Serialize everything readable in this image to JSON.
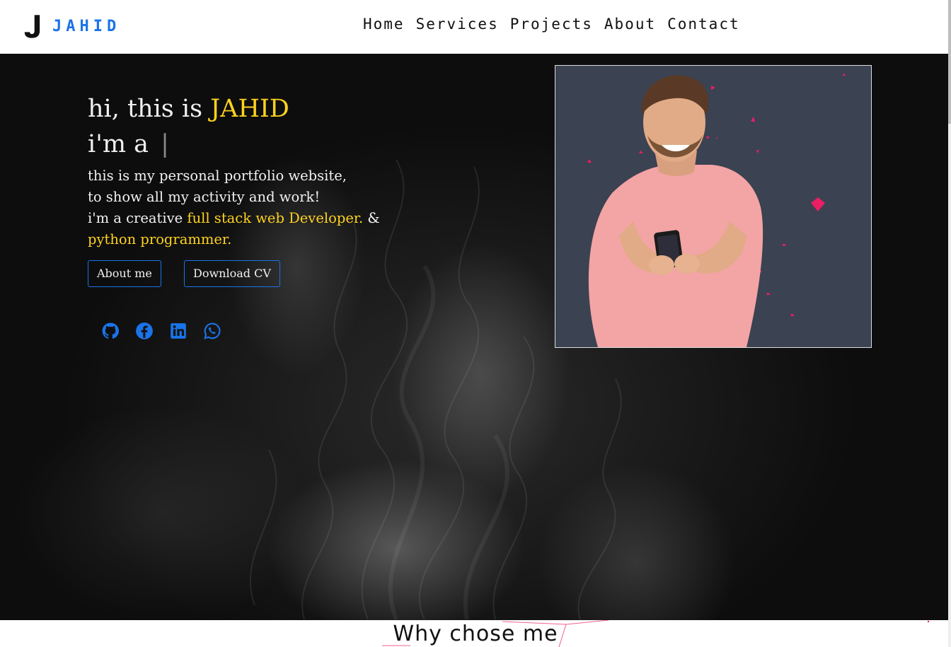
{
  "brand": {
    "logo_letter": "J",
    "name": "JAHID"
  },
  "nav": [
    {
      "label": "Home"
    },
    {
      "label": "Services"
    },
    {
      "label": "Projects"
    },
    {
      "label": "About"
    },
    {
      "label": "Contact"
    }
  ],
  "hero": {
    "greeting": "hi, this is ",
    "name": "JAHID",
    "role_prefix": "i'm a ",
    "cursor": "|",
    "line1": "this is my personal portfolio website,",
    "line2": "to show all my activity and work!",
    "line3_prefix": "i'm a creative ",
    "line3_highlight": "full stack web Developer.",
    "line3_suffix": " &",
    "line4_highlight": "python programmer.",
    "buttons": {
      "about": "About me",
      "cv": "Download CV"
    },
    "socials": [
      "github-icon",
      "facebook-icon",
      "linkedin-icon",
      "whatsapp-icon"
    ]
  },
  "section": {
    "title": "Why chose me"
  },
  "colors": {
    "accent": "#1a73e8",
    "highlight": "#ffd21f",
    "photo_bg": "#3b4252",
    "shirt": "#f3a4a4",
    "confetti": "#e91e63"
  }
}
